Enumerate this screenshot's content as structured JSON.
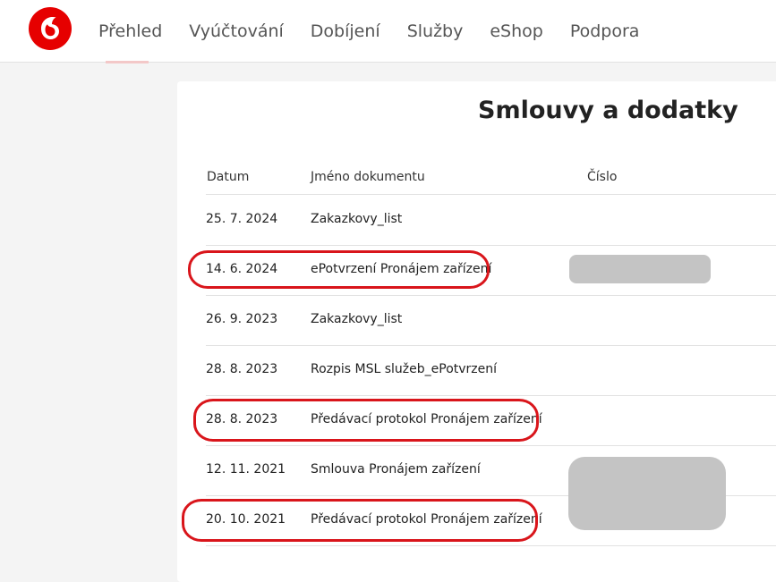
{
  "nav": {
    "items": [
      "Přehled",
      "Vyúčtování",
      "Dobíjení",
      "Služby",
      "eShop",
      "Podpora"
    ],
    "active": "Přehled"
  },
  "page": {
    "title": "Smlouvy a dodatky"
  },
  "table": {
    "headers": [
      "Datum",
      "Jméno dokumentu",
      "Číslo"
    ],
    "rows": [
      {
        "date": "25. 7. 2024",
        "name": "Zakazkovy_list"
      },
      {
        "date": "14. 6. 2024",
        "name": "ePotvrzení Pronájem zařízení"
      },
      {
        "date": "26. 9. 2023",
        "name": "Zakazkovy_list"
      },
      {
        "date": "28. 8. 2023",
        "name": "Rozpis MSL služeb_ePotvrzení"
      },
      {
        "date": "28. 8. 2023",
        "name": "Předávací protokol Pronájem zařízení"
      },
      {
        "date": "12. 11. 2021",
        "name": "Smlouva Pronájem zařízení"
      },
      {
        "date": "20. 10. 2021",
        "name": "Předávací protokol Pronájem zařízení"
      }
    ]
  },
  "colors": {
    "brand_red": "#e60000",
    "annotation_red": "#d9151b",
    "redaction_gray": "#c4c4c4"
  }
}
